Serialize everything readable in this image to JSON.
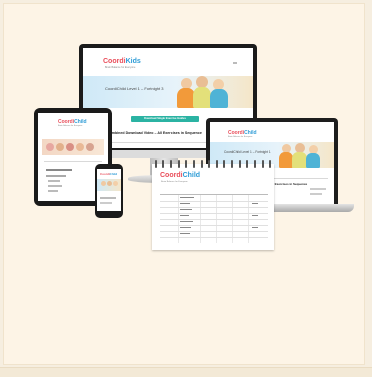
{
  "brand": {
    "logo_part1": "Coordi",
    "logo_part2": "Kids",
    "logo_child_part1": "Coordi",
    "logo_child_part2": "Child",
    "tagline": "Brain Balance for Everyone"
  },
  "desktop": {
    "hero_title": "CoordiChild Level 1 – Fortnight 3",
    "button_label": "Download Single Exercise Guides",
    "section_title": "Combined Download Video – All Exercises in Sequence"
  },
  "laptop": {
    "hero_title": "CoordiChild Level 1 – Fortnight 1",
    "section_title": "All Exercises in Sequence"
  },
  "colors": {
    "logo_red": "#e94e5b",
    "logo_blue": "#2e9cd6",
    "accent_teal": "#2bb3a3",
    "background": "#fdf4e6"
  }
}
